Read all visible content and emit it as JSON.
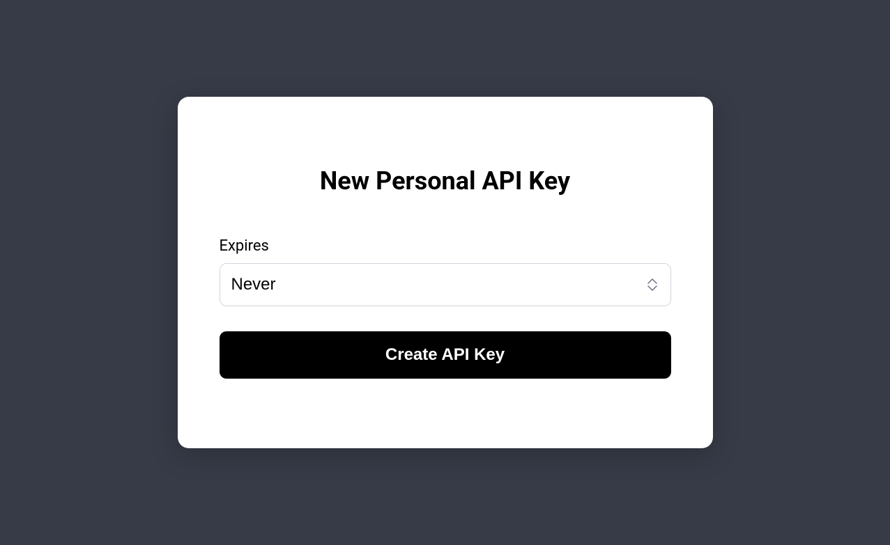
{
  "modal": {
    "title": "New Personal API Key",
    "expires": {
      "label": "Expires",
      "selected_value": "Never"
    },
    "submit_button": {
      "label": "Create API Key"
    }
  }
}
